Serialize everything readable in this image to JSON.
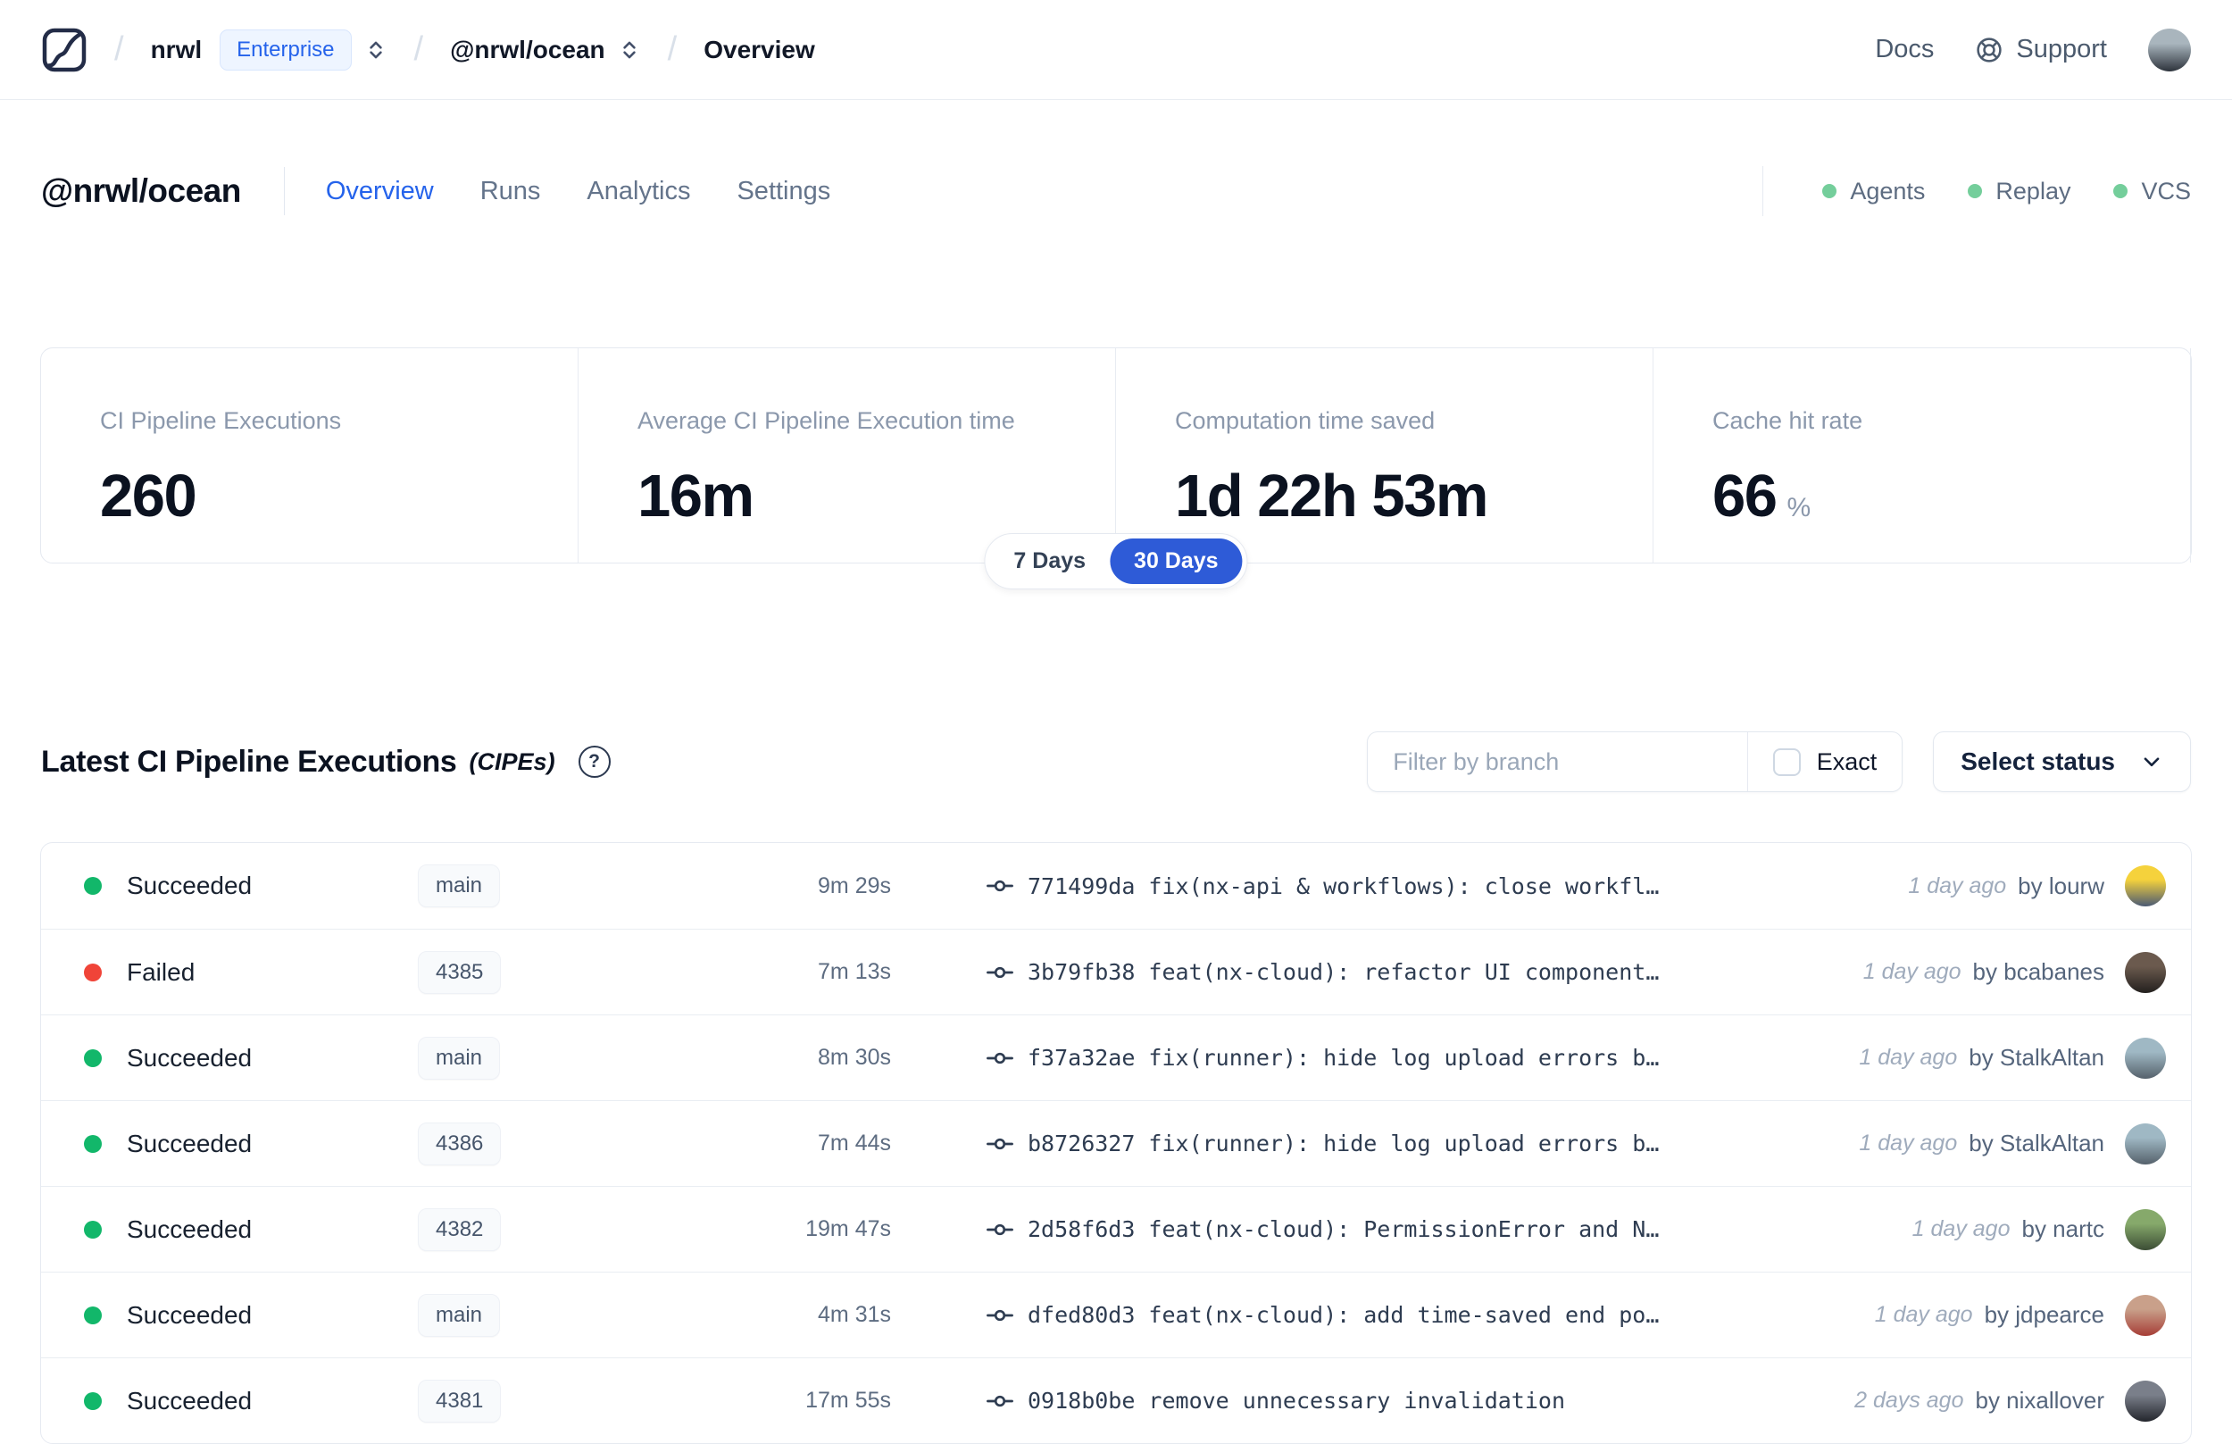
{
  "colors": {
    "accent_blue": "#2e5bd7",
    "enterprise_blue": "#2563eb",
    "status_green": "#12b76a",
    "status_red": "#f04438",
    "integration_green": "#74ce9b"
  },
  "topbar": {
    "logo_icon": "nx-logo",
    "breadcrumb": {
      "separator": "/",
      "org": "nrwl",
      "org_badge": "Enterprise",
      "org_selector_icon": "unfold-icon",
      "workspace": "@nrwl/ocean",
      "workspace_selector_icon": "unfold-icon",
      "page": "Overview"
    },
    "docs_label": "Docs",
    "support_icon": "lifebuoy-icon",
    "support_label": "Support",
    "avatar_colors": [
      "#a9b5bd",
      "#2d333c"
    ]
  },
  "workspace_header": {
    "title": "@nrwl/ocean",
    "tabs": [
      {
        "label": "Overview",
        "active": true
      },
      {
        "label": "Runs",
        "active": false
      },
      {
        "label": "Analytics",
        "active": false
      },
      {
        "label": "Settings",
        "active": false
      }
    ],
    "integrations": [
      {
        "label": "Agents"
      },
      {
        "label": "Replay"
      },
      {
        "label": "VCS"
      }
    ]
  },
  "stats": {
    "cards": [
      {
        "label": "CI Pipeline Executions",
        "value": "260"
      },
      {
        "label": "Average CI Pipeline Execution time",
        "value": "16m"
      },
      {
        "label": "Computation time saved",
        "value": "1d 22h 53m"
      },
      {
        "label": "Cache hit rate",
        "value": "66",
        "unit": "%"
      }
    ],
    "range_toggle": {
      "options": [
        "7 Days",
        "30 Days"
      ],
      "selected": "30 Days"
    }
  },
  "cipe_section": {
    "title": "Latest CI Pipeline Executions",
    "title_suffix": "(CIPEs)",
    "help_icon": "?",
    "filter_placeholder": "Filter by branch",
    "exact_label": "Exact",
    "status_select_label": "Select status",
    "rows": [
      {
        "status": "Succeeded",
        "branch": "main",
        "duration": "9m 29s",
        "commit_sha": "771499da",
        "commit_message": "fix(nx-api & workflows): close workfl…",
        "time_ago": "1 day ago",
        "author": "by lourw",
        "avatar_colors": [
          "#f5d23c",
          "#4b5a74"
        ]
      },
      {
        "status": "Failed",
        "branch": "4385",
        "duration": "7m 13s",
        "commit_sha": "3b79fb38",
        "commit_message": "feat(nx-cloud): refactor UI component…",
        "time_ago": "1 day ago",
        "author": "by bcabanes",
        "avatar_colors": [
          "#6b5a4e",
          "#23201e"
        ]
      },
      {
        "status": "Succeeded",
        "branch": "main",
        "duration": "8m 30s",
        "commit_sha": "f37a32ae",
        "commit_message": "fix(runner): hide log upload errors b…",
        "time_ago": "1 day ago",
        "author": "by StalkAltan",
        "avatar_colors": [
          "#9fb8c4",
          "#55616b"
        ]
      },
      {
        "status": "Succeeded",
        "branch": "4386",
        "duration": "7m 44s",
        "commit_sha": "b8726327",
        "commit_message": "fix(runner): hide log upload errors b…",
        "time_ago": "1 day ago",
        "author": "by StalkAltan",
        "avatar_colors": [
          "#9fb8c4",
          "#55616b"
        ]
      },
      {
        "status": "Succeeded",
        "branch": "4382",
        "duration": "19m 47s",
        "commit_sha": "2d58f6d3",
        "commit_message": "feat(nx-cloud): PermissionError and N…",
        "time_ago": "1 day ago",
        "author": "by nartc",
        "avatar_colors": [
          "#86a96b",
          "#3c4d35"
        ]
      },
      {
        "status": "Succeeded",
        "branch": "main",
        "duration": "4m 31s",
        "commit_sha": "dfed80d3",
        "commit_message": "feat(nx-cloud): add time-saved end po…",
        "time_ago": "1 day ago",
        "author": "by jdpearce",
        "avatar_colors": [
          "#c9a08a",
          "#a63d36"
        ]
      },
      {
        "status": "Succeeded",
        "branch": "4381",
        "duration": "17m 55s",
        "commit_sha": "0918b0be",
        "commit_message": "remove unnecessary invalidation",
        "time_ago": "2 days ago",
        "author": "by nixallover",
        "avatar_colors": [
          "#7a7f8a",
          "#23252c"
        ]
      }
    ]
  }
}
